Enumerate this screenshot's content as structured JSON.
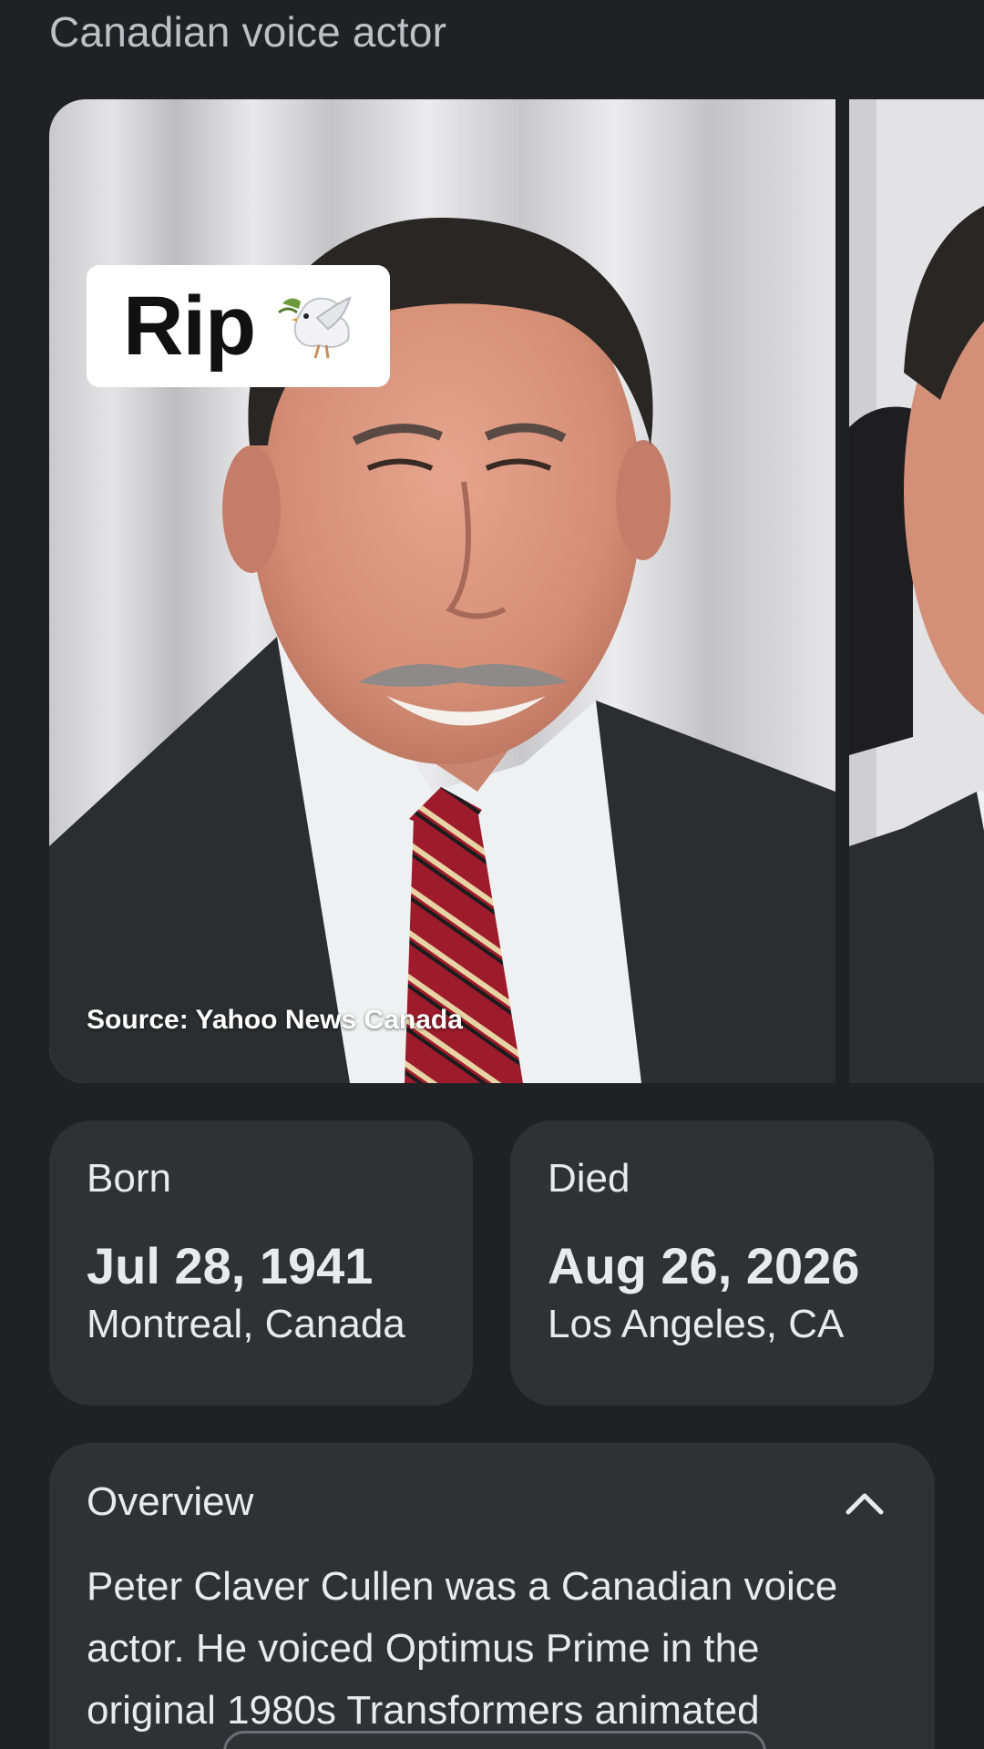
{
  "header": {
    "subtitle": "Canadian voice actor"
  },
  "carousel": {
    "tag_text": "Rip",
    "tag_icon": "dove-icon",
    "source": "Source: Yahoo News Canada"
  },
  "facts": {
    "born": {
      "label": "Born",
      "date": "Jul 28, 1941",
      "place": "Montreal, Canada"
    },
    "died": {
      "label": "Died",
      "date": "Aug 26, 2026",
      "place": "Los Angeles, CA"
    }
  },
  "overview": {
    "title": "Overview",
    "toggle_icon": "chevron-up-icon",
    "text": "Peter Claver Cullen was a Canadian voice actor. He voiced Optimus Prime in the original 1980s Transformers animated"
  },
  "colors": {
    "background": "#202124",
    "card": "#303134",
    "text": "#e8eaed",
    "muted": "#bdc1c6"
  }
}
